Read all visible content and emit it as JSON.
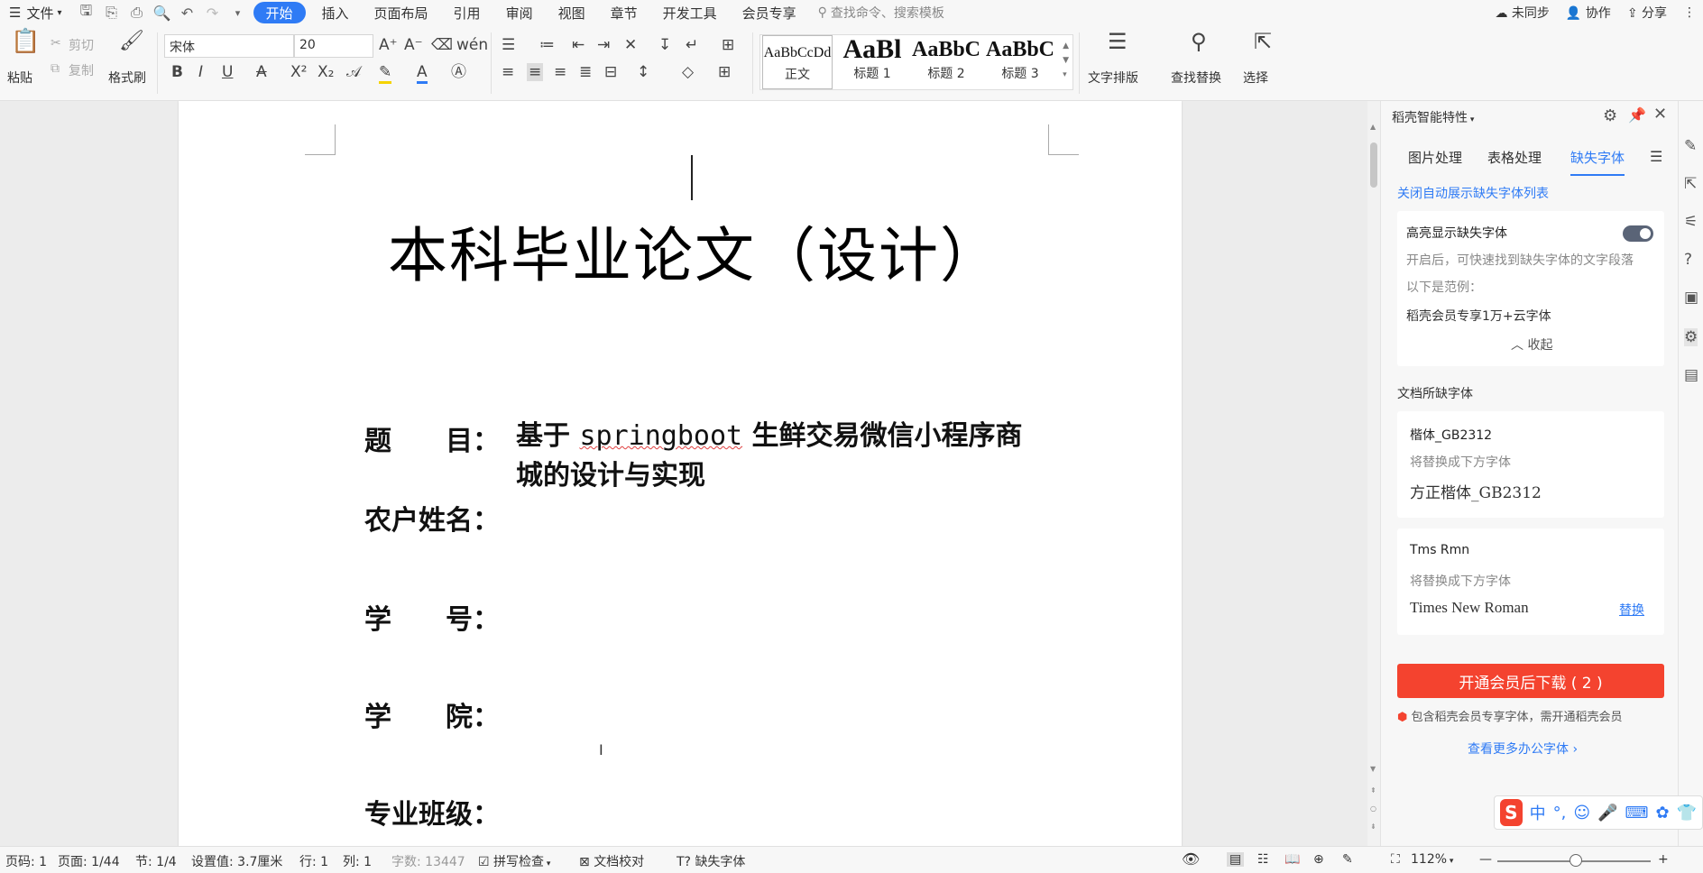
{
  "menubar": {
    "file": "文件",
    "tabs": [
      "开始",
      "插入",
      "页面布局",
      "引用",
      "审阅",
      "视图",
      "章节",
      "开发工具",
      "会员专享"
    ],
    "search_placeholder": "查找命令、搜索模板",
    "right": [
      "未同步",
      "协作",
      "分享"
    ]
  },
  "ribbon": {
    "paste": "粘贴",
    "cut": "剪切",
    "copy": "复制",
    "format_painter": "格式刷",
    "font_name": "宋体",
    "font_size": "20",
    "styles": [
      {
        "preview": "AaBbCcDd",
        "label": "正文"
      },
      {
        "preview": "AaBl",
        "label": "标题 1"
      },
      {
        "preview": "AaBbC",
        "label": "标题 2"
      },
      {
        "preview": "AaBbC",
        "label": "标题 3"
      }
    ],
    "text_layout": "文字排版",
    "find_replace": "查找替换",
    "select": "选择"
  },
  "document": {
    "title": "本科毕业论文（设计）",
    "fields": [
      {
        "label": "题　　目：",
        "value_prefix": "基于 ",
        "value_code": "springboot",
        "value_suffix": " 生鲜交易微信小程序商",
        "value_line2": "城的设计与实现"
      },
      {
        "label": "农户姓名："
      },
      {
        "label": "学　　号："
      },
      {
        "label": "学　　院："
      },
      {
        "label": "专业班级："
      }
    ]
  },
  "panel": {
    "header": "稻壳智能特性",
    "tabs": [
      "图片处理",
      "表格处理",
      "缺失字体"
    ],
    "close_auto": "关闭自动展示缺失字体列表",
    "highlight_title": "高亮显示缺失字体",
    "highlight_desc1": "开启后，可快速找到缺失字体的文字段落",
    "highlight_desc2": "以下是范例：",
    "highlight_example": "稻壳会员专享1万+云字体",
    "collapse": "收起",
    "missing_header": "文档所缺字体",
    "fonts": [
      {
        "name": "楷体_GB2312",
        "hint": "将替换成下方字体",
        "replacement": "方正楷体_GB2312",
        "action": ""
      },
      {
        "name": "Tms Rmn",
        "hint": "将替换成下方字体",
        "replacement": "Times New Roman",
        "action": "替换"
      }
    ],
    "cta": "开通会员后下载 ( 2 )",
    "member_note": "包含稻壳会员专享字体，需开通稻壳会员",
    "more_fonts": "查看更多办公字体"
  },
  "ime": {
    "logo": "S",
    "mode": "中"
  },
  "status": {
    "page_no": "页码: 1",
    "page": "页面: 1/44",
    "section": "节: 1/4",
    "setting": "设置值: 3.7厘米",
    "row": "行: 1",
    "col": "列: 1",
    "words": "字数: 13447",
    "spell": "拼写检查",
    "proof": "文档校对",
    "missing_font": "缺失字体",
    "zoom": "112%"
  },
  "colors": {
    "accent": "#2f7bf5",
    "cta": "#f4432f"
  }
}
